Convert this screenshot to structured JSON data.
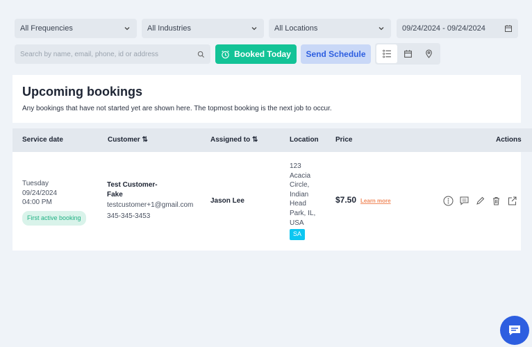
{
  "filters": {
    "frequency": "All Frequencies",
    "industry": "All Industries",
    "location": "All Locations",
    "date_range": "09/24/2024 - 09/24/2024"
  },
  "search": {
    "placeholder": "Search by name, email, phone, id or address"
  },
  "buttons": {
    "booked_today": "Booked Today",
    "send_schedule": "Send Schedule"
  },
  "header": {
    "title": "Upcoming bookings",
    "description": "Any bookings that have not started yet are shown here. The topmost booking is the next job to occur."
  },
  "columns": {
    "service_date": "Service date",
    "customer": "Customer",
    "assigned_to": "Assigned to",
    "location": "Location",
    "price": "Price",
    "actions": "Actions"
  },
  "booking": {
    "day": "Tuesday",
    "date": "09/24/2024",
    "time": "04:00 PM",
    "badge": "First active booking",
    "customer_name": "Test Customer-Fake",
    "email": "testcustomer+1@gmail.com",
    "phone": "345-345-3453",
    "assigned": "Jason Lee",
    "location": "123 Acacia Circle, Indian Head Park, IL, USA",
    "location_tag": "SA",
    "price": "$7.50",
    "learn_more": "Learn more"
  },
  "colors": {
    "green": "#13c397",
    "blue_btn": "#c9d8f7",
    "accent": "#2d5ee0",
    "tag": "#0cc6f1",
    "link": "#f08a5d"
  }
}
